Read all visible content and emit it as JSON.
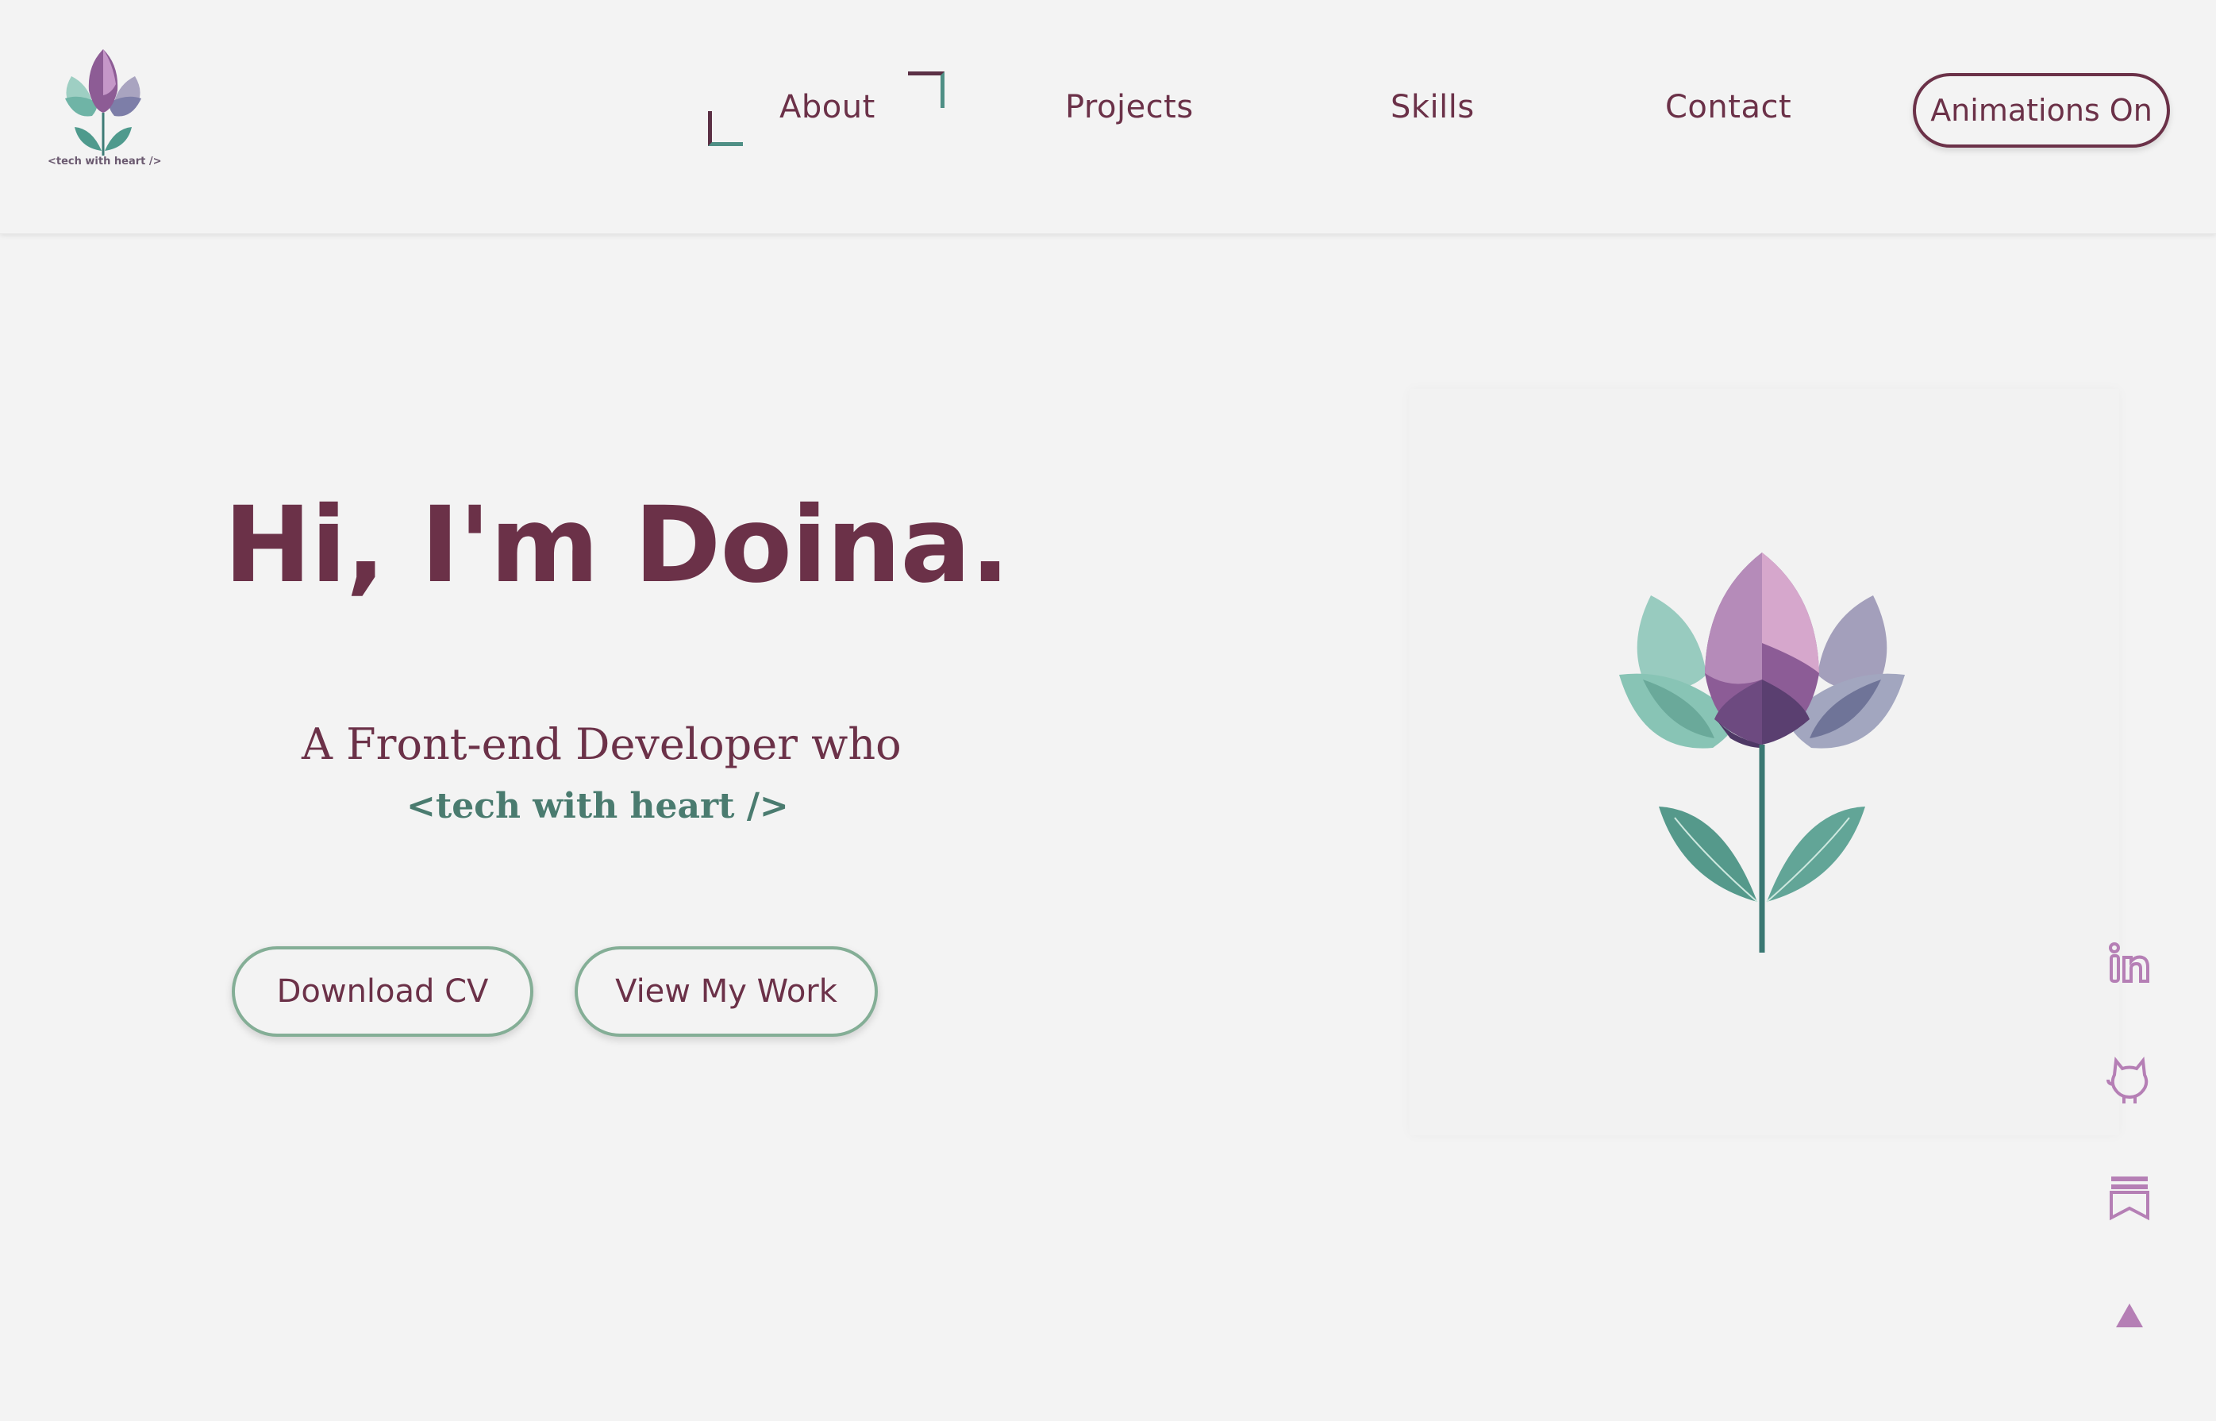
{
  "header": {
    "logo_text": "<tech with heart />",
    "nav": [
      {
        "label": "About"
      },
      {
        "label": "Projects"
      },
      {
        "label": "Skills"
      },
      {
        "label": "Contact"
      }
    ],
    "animations_button": "Animations On"
  },
  "hero": {
    "title": "Hi, I'm Doina.",
    "subtitle": "A Front-end Developer who",
    "tagline": "<tech with heart />",
    "buttons": {
      "download_cv": "Download CV",
      "view_work": "View My Work"
    }
  },
  "social": [
    {
      "icon": "linkedin-icon"
    },
    {
      "icon": "github-icon"
    },
    {
      "icon": "blog-icon"
    },
    {
      "icon": "scroll-top-icon"
    }
  ],
  "colors": {
    "primary": "#6b3148",
    "accent_green": "#4a7b6f",
    "button_border": "#84ae96",
    "background": "#f3f3f3",
    "icon_purple": "#b57fb5"
  }
}
